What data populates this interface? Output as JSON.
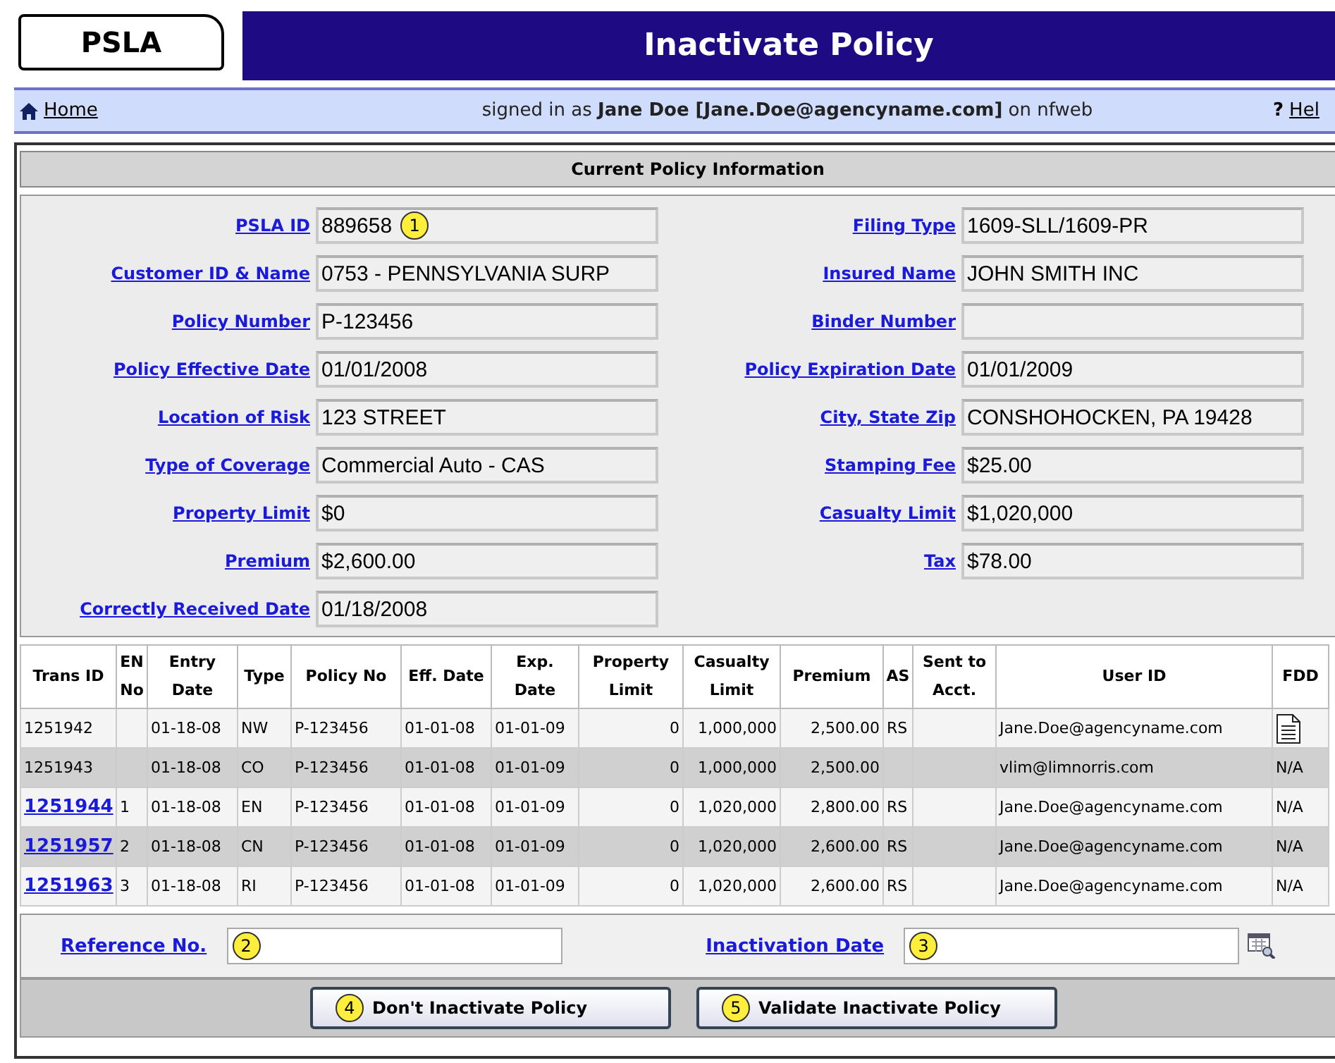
{
  "logo": "PSLA",
  "title": "Inactivate Policy",
  "nav": {
    "home": "Home",
    "signed_prefix": "signed in as",
    "user": "Jane Doe [Jane.Doe@agencyname.com]",
    "signed_suffix": "on nfweb",
    "help_icon": "?",
    "help": "Hel"
  },
  "section_title": "Current Policy Information",
  "left_fields": [
    {
      "label": "PSLA ID",
      "value": "889658",
      "callout": "1"
    },
    {
      "label": "Customer ID & Name",
      "value": "0753 - PENNSYLVANIA SURP"
    },
    {
      "label": "Policy Number",
      "value": "P-123456"
    },
    {
      "label": "Policy Effective Date",
      "value": "01/01/2008"
    },
    {
      "label": "Location of Risk",
      "value": "123 STREET"
    },
    {
      "label": "Type of Coverage",
      "value": "Commercial Auto - CAS"
    },
    {
      "label": "Property Limit",
      "value": "$0"
    },
    {
      "label": "Premium",
      "value": "$2,600.00"
    },
    {
      "label": "Correctly Received Date",
      "value": "01/18/2008"
    }
  ],
  "right_fields": [
    {
      "label": "Filing Type",
      "value": "1609-SLL/1609-PR"
    },
    {
      "label": "Insured Name",
      "value": "JOHN SMITH INC"
    },
    {
      "label": "Binder Number"
    },
    {
      "label": "Policy Expiration Date",
      "value": "01/01/2009"
    },
    {
      "label": "City, State Zip",
      "value": "CONSHOHOCKEN, PA 19428"
    },
    {
      "label": "Stamping Fee",
      "value": "$25.00"
    },
    {
      "label": "Casualty Limit",
      "value": "$1,020,000"
    },
    {
      "label": "Tax",
      "value": "$78.00"
    }
  ],
  "table": {
    "columns": [
      "Trans ID",
      "EN No",
      "Entry Date",
      "Type",
      "Policy No",
      "Eff. Date",
      "Exp. Date",
      "Property Limit",
      "Casualty Limit",
      "Premium",
      "AS",
      "Sent to Acct.",
      "User ID",
      "FDD"
    ],
    "rows": [
      {
        "trans_id": "1251942",
        "link": false,
        "entry_date": "01-18-08",
        "type": "NW",
        "policy_no": "P-123456",
        "eff_date": "01-01-08",
        "exp_date": "01-01-09",
        "property_limit": "0",
        "casualty_limit": "1,000,000",
        "premium": "2,500.00",
        "as": "RS",
        "user_id": "Jane.Doe@agencyname.com",
        "fdd": {
          "kind": "document"
        }
      },
      {
        "trans_id": "1251943",
        "link": false,
        "entry_date": "01-18-08",
        "type": "CO",
        "policy_no": "P-123456",
        "eff_date": "01-01-08",
        "exp_date": "01-01-09",
        "property_limit": "0",
        "casualty_limit": "1,000,000",
        "premium": "2,500.00",
        "user_id": "vlim@limnorris.com",
        "fdd": {
          "kind": "text",
          "text": "N/A"
        }
      },
      {
        "trans_id": "1251944",
        "link": true,
        "en_no": "1",
        "entry_date": "01-18-08",
        "type": "EN",
        "policy_no": "P-123456",
        "eff_date": "01-01-08",
        "exp_date": "01-01-09",
        "property_limit": "0",
        "casualty_limit": "1,020,000",
        "premium": "2,800.00",
        "as": "RS",
        "user_id": "Jane.Doe@agencyname.com",
        "fdd": {
          "kind": "text",
          "text": "N/A"
        }
      },
      {
        "trans_id": "1251957",
        "link": true,
        "en_no": "2",
        "entry_date": "01-18-08",
        "type": "CN",
        "policy_no": "P-123456",
        "eff_date": "01-01-08",
        "exp_date": "01-01-09",
        "property_limit": "0",
        "casualty_limit": "1,020,000",
        "premium": "2,600.00",
        "as": "RS",
        "user_id": "Jane.Doe@agencyname.com",
        "fdd": {
          "kind": "text",
          "text": "N/A"
        }
      },
      {
        "trans_id": "1251963",
        "link": true,
        "en_no": "3",
        "entry_date": "01-18-08",
        "type": "RI",
        "policy_no": "P-123456",
        "eff_date": "01-01-08",
        "exp_date": "01-01-09",
        "property_limit": "0",
        "casualty_limit": "1,020,000",
        "premium": "2,600.00",
        "as": "RS",
        "user_id": "Jane.Doe@agencyname.com",
        "fdd": {
          "kind": "text",
          "text": "N/A"
        }
      }
    ]
  },
  "reference": {
    "label": "Reference No.",
    "callout": "2"
  },
  "inactivation": {
    "label": "Inactivation Date",
    "callout": "3"
  },
  "buttons": [
    {
      "label": "Don't Inactivate Policy",
      "callout": "4"
    },
    {
      "label": "Validate Inactivate Policy",
      "callout": "5"
    }
  ]
}
